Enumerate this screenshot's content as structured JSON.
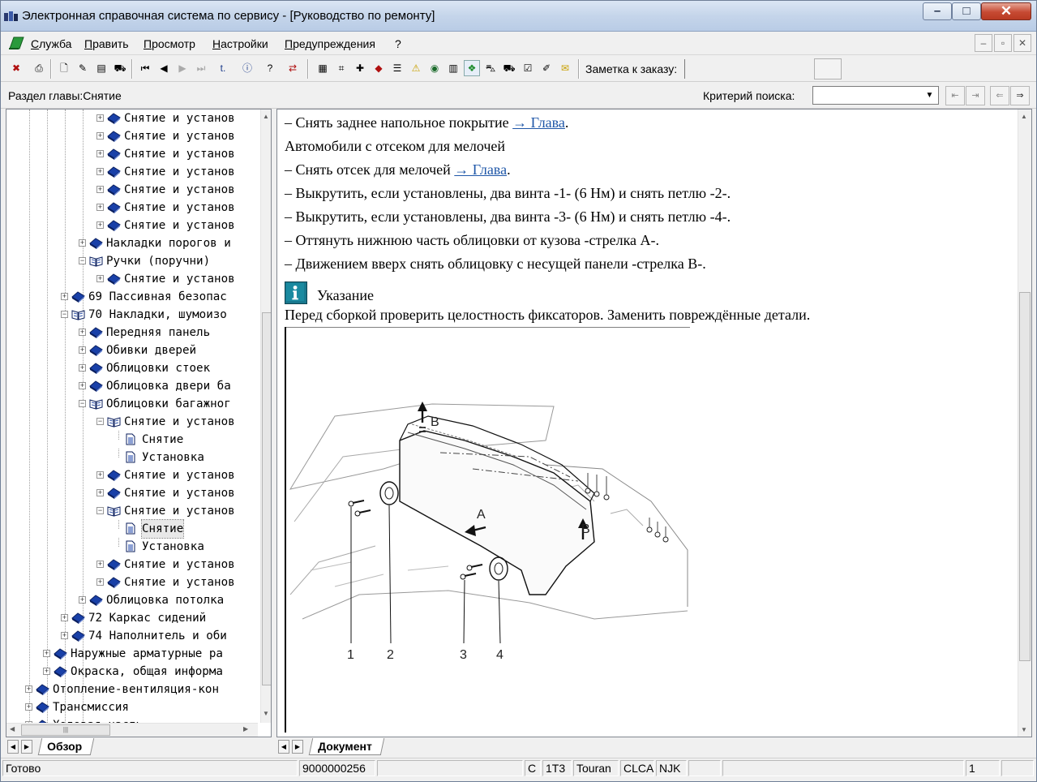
{
  "window": {
    "title": "Электронная справочная система по сервису - [Руководство по ремонту]"
  },
  "menu": [
    "Служба",
    "Править",
    "Просмотр",
    "Настройки",
    "Предупреждения",
    "?"
  ],
  "toolbar": {
    "order_note_label": "Заметка к заказу:"
  },
  "section": {
    "label": "Раздел главы:Снятие"
  },
  "search": {
    "label": "Критерий  поиска:",
    "value": ""
  },
  "tree": [
    {
      "label": "Снятие и установ",
      "level": 4,
      "expander": "+",
      "icon": "book-icon",
      "expanded": false
    },
    {
      "label": "Снятие и установ",
      "level": 4,
      "expander": "+",
      "icon": "book-icon",
      "expanded": false
    },
    {
      "label": "Снятие и установ",
      "level": 4,
      "expander": "+",
      "icon": "book-icon",
      "expanded": false
    },
    {
      "label": "Снятие и установ",
      "level": 4,
      "expander": "+",
      "icon": "book-icon",
      "expanded": false
    },
    {
      "label": "Снятие и установ",
      "level": 4,
      "expander": "+",
      "icon": "book-icon",
      "expanded": false
    },
    {
      "label": "Снятие и установ",
      "level": 4,
      "expander": "+",
      "icon": "book-icon",
      "expanded": false
    },
    {
      "label": "Снятие и установ",
      "level": 4,
      "expander": "+",
      "icon": "book-icon",
      "expanded": false
    },
    {
      "label": "Накладки порогов и",
      "level": 3,
      "expander": "+",
      "icon": "book-icon",
      "expanded": false
    },
    {
      "label": "Ручки (поручни)",
      "level": 3,
      "expander": "-",
      "icon": "open-book-icon",
      "expanded": true
    },
    {
      "label": "Снятие и установ",
      "level": 4,
      "expander": "+",
      "icon": "book-icon",
      "expanded": false
    },
    {
      "label": "69 Пассивная безопас",
      "level": 2,
      "expander": "+",
      "icon": "book-icon",
      "expanded": false
    },
    {
      "label": "70 Накладки, шумоизо",
      "level": 2,
      "expander": "-",
      "icon": "open-book-icon",
      "expanded": true
    },
    {
      "label": "Передняя панель",
      "level": 3,
      "expander": "+",
      "icon": "book-icon",
      "expanded": false
    },
    {
      "label": "Обивки дверей",
      "level": 3,
      "expander": "+",
      "icon": "book-icon",
      "expanded": false
    },
    {
      "label": "Облицовки стоек",
      "level": 3,
      "expander": "+",
      "icon": "book-icon",
      "expanded": false
    },
    {
      "label": "Облицовка двери ба",
      "level": 3,
      "expander": "+",
      "icon": "book-icon",
      "expanded": false
    },
    {
      "label": "Облицовки багажног",
      "level": 3,
      "expander": "-",
      "icon": "open-book-icon",
      "expanded": true
    },
    {
      "label": "Снятие и установ",
      "level": 4,
      "expander": "-",
      "icon": "open-book-icon",
      "expanded": true
    },
    {
      "label": "Снятие",
      "level": 5,
      "expander": "",
      "icon": "page-icon",
      "expanded": false
    },
    {
      "label": "Установка",
      "level": 5,
      "expander": "",
      "icon": "page-icon",
      "expanded": false
    },
    {
      "label": "Снятие и установ",
      "level": 4,
      "expander": "+",
      "icon": "book-icon",
      "expanded": false
    },
    {
      "label": "Снятие и установ",
      "level": 4,
      "expander": "+",
      "icon": "book-icon",
      "expanded": false
    },
    {
      "label": "Снятие и установ",
      "level": 4,
      "expander": "-",
      "icon": "open-book-icon",
      "expanded": true
    },
    {
      "label": "Снятие",
      "level": 5,
      "expander": "",
      "icon": "page-icon",
      "expanded": false,
      "selected": true
    },
    {
      "label": "Установка",
      "level": 5,
      "expander": "",
      "icon": "page-icon",
      "expanded": false
    },
    {
      "label": "Снятие и установ",
      "level": 4,
      "expander": "+",
      "icon": "book-icon",
      "expanded": false
    },
    {
      "label": "Снятие и установ",
      "level": 4,
      "expander": "+",
      "icon": "book-icon",
      "expanded": false
    },
    {
      "label": "Облицовка потолка",
      "level": 3,
      "expander": "+",
      "icon": "book-icon",
      "expanded": false
    },
    {
      "label": "72 Каркас сидений",
      "level": 2,
      "expander": "+",
      "icon": "book-icon",
      "expanded": false
    },
    {
      "label": "74 Наполнитель и оби",
      "level": 2,
      "expander": "+",
      "icon": "book-icon",
      "expanded": false
    },
    {
      "label": "Наружные арматурные ра",
      "level": 1,
      "expander": "+",
      "icon": "book-icon",
      "expanded": false
    },
    {
      "label": "Окраска, общая информа",
      "level": 1,
      "expander": "+",
      "icon": "book-icon",
      "expanded": false
    },
    {
      "label": "Отопление-вентиляция-кон",
      "level": 0,
      "expander": "+",
      "icon": "book-icon",
      "expanded": false
    },
    {
      "label": "Трансмиссия",
      "level": 0,
      "expander": "+",
      "icon": "book-icon",
      "expanded": false
    },
    {
      "label": "Ходовая часть",
      "level": 0,
      "expander": "+",
      "icon": "book-icon",
      "expanded": false
    }
  ],
  "tabs": {
    "left": "Обзор",
    "right": "Документ"
  },
  "document": {
    "lines": [
      {
        "text": "–  Снять заднее напольное покрытие ",
        "link": "→ Глава",
        "after": "."
      },
      {
        "text": "Автомобили с отсеком для мелочей",
        "link": "",
        "after": ""
      },
      {
        "text": "–  Снять отсек для мелочей ",
        "link": "→ Глава",
        "after": "."
      },
      {
        "text": "–  Выкрутить, если установлены, два винта -1- (6 Нм) и снять петлю -2-.",
        "link": "",
        "after": ""
      },
      {
        "text": "–  Выкрутить, если установлены, два винта -3- (6 Нм) и снять петлю -4-.",
        "link": "",
        "after": ""
      },
      {
        "text": "–  Оттянуть нижнюю часть облицовки от кузова -стрелка A-.",
        "link": "",
        "after": ""
      },
      {
        "text": "–  Движением вверх снять облицовку с несущей панели -стрелка B-.",
        "link": "",
        "after": ""
      }
    ],
    "note_label": "Указание",
    "note_text": "Перед сборкой проверить целостность фиксаторов. Заменить повреждённые детали.",
    "figure_labels": {
      "n1": "1",
      "n2": "2",
      "n3": "3",
      "n4": "4",
      "a": "A",
      "b1": "B",
      "b2": "B"
    }
  },
  "status": [
    "Готово",
    "9000000256",
    "",
    "C",
    "1T3",
    "Touran",
    "CLCA",
    "NJK",
    "",
    "",
    "1",
    ""
  ],
  "colors": {
    "accent": "#1f57a8",
    "book": "#1940a8",
    "note_icon": "#18778d"
  }
}
